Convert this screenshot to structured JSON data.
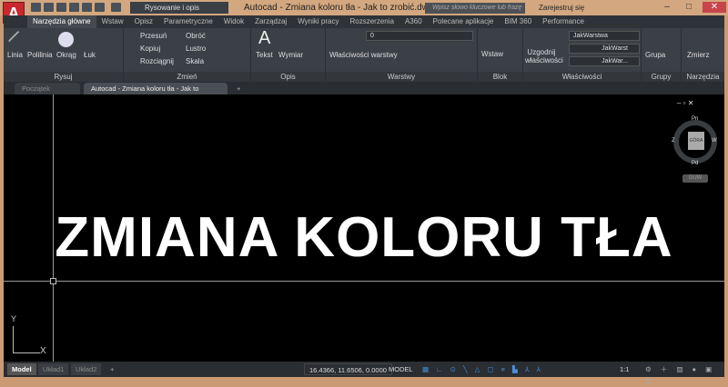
{
  "app": {
    "logo_letter": "A",
    "title": "Autocad - Zmiana koloru tła - Jak to zrobić.dwg",
    "workspace": "Rysowanie i opis",
    "search_placeholder": "Wpisz słowo kluczowe lub frazę",
    "signin": "Zarejestruj się"
  },
  "ribbon_tabs": [
    "Narzędzia główne",
    "Wstaw",
    "Opisz",
    "Parametryczne",
    "Widok",
    "Zarządzaj",
    "Wyniki pracy",
    "Rozszerzenia",
    "A360",
    "Polecane aplikacje",
    "BIM 360",
    "Performance"
  ],
  "panels": {
    "rysuj": {
      "title": "Rysuj",
      "tools": [
        "Linia",
        "Polilinia",
        "Okrąg",
        "Łuk"
      ]
    },
    "zmien": {
      "title": "Zmień",
      "tools": [
        "Przesuń",
        "Obróć",
        "Kopiuj",
        "Lustro",
        "Rozciągnij",
        "Skala"
      ]
    },
    "opis": {
      "title": "Opis",
      "tools": [
        "Tekst",
        "Wymiar"
      ]
    },
    "warstwy": {
      "title": "Warstwy",
      "tool": "Właściwości warstwy",
      "layer": "0"
    },
    "blok": {
      "title": "Blok",
      "tool": "Wstaw"
    },
    "wlasciwosci": {
      "title": "Właściwości",
      "tool": "Uzgodnij właściwości",
      "color": "JakWarstwa",
      "linetype": "JakWarst",
      "lineweight": "JakWar..."
    },
    "grupy": {
      "title": "Grupy",
      "tool": "Grupa"
    },
    "narzedzia": {
      "title": "Narzędzia",
      "tool": "Zmierz"
    }
  },
  "doc_tabs": [
    "Początek",
    "Autocad - Zmiana koloru tła - Jak to zrobić*"
  ],
  "canvas": {
    "text": "ZMIANA KOLORU TŁA",
    "background": "#000000",
    "viewcube": {
      "top": "GÓRA",
      "n": "Pn",
      "s": "Pd",
      "e": "W",
      "w": "Z",
      "ucs": "GUW"
    },
    "ucs_x": "X",
    "ucs_y": "Y"
  },
  "layout_tabs": [
    "Model",
    "Układ1",
    "Układ2"
  ],
  "status": {
    "coords": "16.4366, 11.6506, 0.0000",
    "space": "MODEL",
    "scale": "1:1"
  },
  "colors": {
    "accent": "#c8282e",
    "ribbon": "#3b4046",
    "frame": "#d3a77f"
  }
}
